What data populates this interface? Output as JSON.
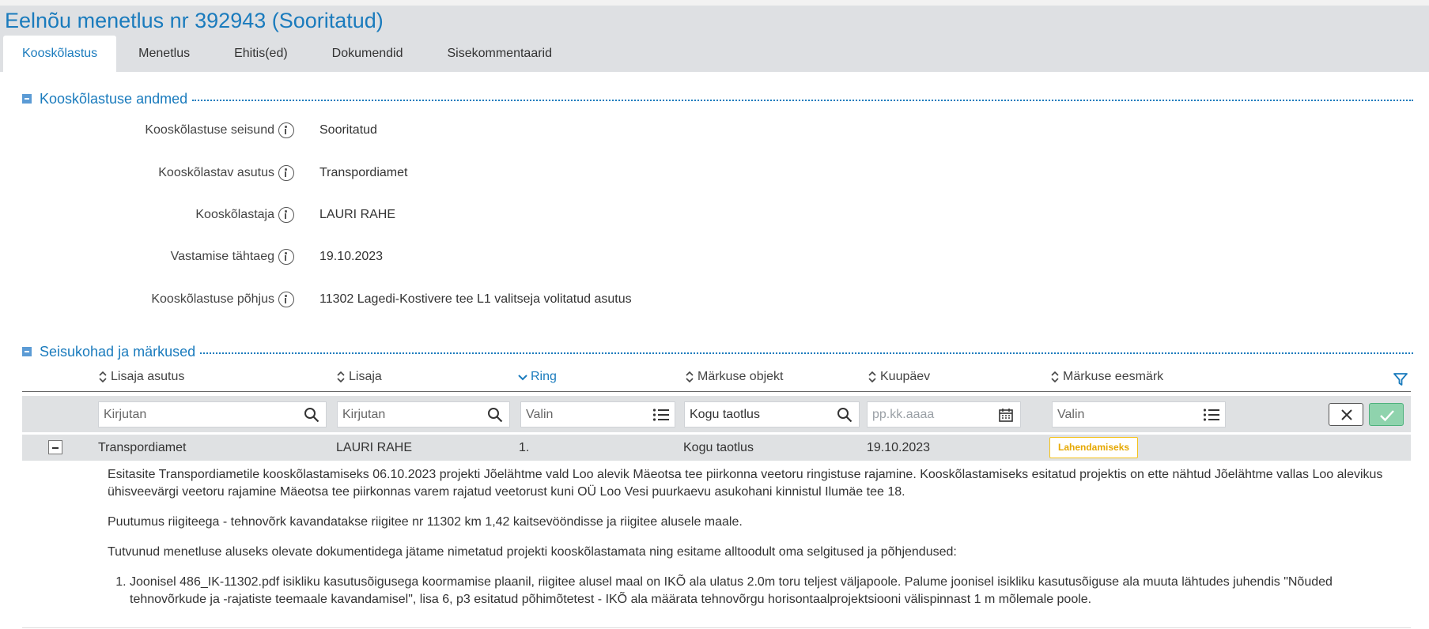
{
  "page": {
    "title": "Eelnõu menetlus nr 392943 (Sooritatud)"
  },
  "tabs": [
    {
      "label": "Kooskõlastus",
      "active": true
    },
    {
      "label": "Menetlus"
    },
    {
      "label": "Ehitis(ed)"
    },
    {
      "label": "Dokumendid"
    },
    {
      "label": "Sisekommentaarid"
    }
  ],
  "section1": {
    "title": "Kooskõlastuse andmed",
    "fields": [
      {
        "label": "Kooskõlastuse seisund",
        "value": "Sooritatud"
      },
      {
        "label": "Kooskõlastav asutus",
        "value": "Transpordiamet"
      },
      {
        "label": "Kooskõlastaja",
        "value": "LAURI RAHE"
      },
      {
        "label": "Vastamise tähtaeg",
        "value": "19.10.2023"
      },
      {
        "label": "Kooskõlastuse põhjus",
        "value": "11302 Lagedi-Kostivere tee L1 valitseja volitatud asutus"
      }
    ]
  },
  "section2": {
    "title": "Seisukohad ja märkused",
    "columns": [
      "Lisaja asutus",
      "Lisaja",
      "Ring",
      "Märkuse objekt",
      "Kuupäev",
      "Märkuse eesmärk"
    ],
    "filters": {
      "lisaja_asutus": "Kirjutan",
      "lisaja": "Kirjutan",
      "ring": "Valin",
      "markuse_objekt": "Kogu taotlus",
      "kuupaev": "pp.kk.aaaa",
      "markuse_eesmark": "Valin"
    },
    "row": {
      "lisaja_asutus": "Transpordiamet",
      "lisaja": "LAURI RAHE",
      "ring": "1.",
      "markuse_objekt": "Kogu taotlus",
      "kuupaev": "19.10.2023",
      "markuse_eesmark": "Lahendamiseks"
    },
    "detail": {
      "p1": "Esitasite Transpordiametile kooskõlastamiseks 06.10.2023 projekti Jõelähtme vald Loo alevik Mäeotsa tee piirkonna veetoru ringistuse rajamine. Kooskõlastamiseks esitatud projektis on ette nähtud Jõelähtme vallas Loo alevikus ühisveevärgi veetoru rajamine Mäeotsa tee piirkonnas varem rajatud veetorust kuni OÜ Loo Vesi puurkaevu asukohani kinnistul Ilumäe tee 18.",
      "p2": "Puutumus riigiteega - tehnovõrk kavandatakse riigitee nr 11302 km 1,42 kaitsevööndisse ja riigitee alusele maale.",
      "p3": "Tutvunud menetluse aluseks olevate dokumentidega jätame nimetatud projekti kooskõlastamata ning esitame alltoodult oma selgitused ja põhjendused:",
      "list": [
        "Joonisel 486_IK-11302.pdf isikliku kasutusõigusega koormamise plaanil, riigitee alusel maal on IKÕ ala ulatus 2.0m toru teljest väljapoole. Palume joonisel isikliku kasutusõiguse ala muuta lähtudes juhendis \"Nõuded tehnovõrkude ja -rajatiste teemaale kavandamisel\", lisa 6, p3 esitatud põhimõtetest - IKÕ ala määrata tehnovõrgu horisontaalprojektsiooni välispinnast 1 m mõlemale poole."
      ]
    }
  },
  "colors": {
    "accent": "#1a7bbd",
    "badge": "#f5c21a",
    "ok": "#8fd3ad"
  }
}
